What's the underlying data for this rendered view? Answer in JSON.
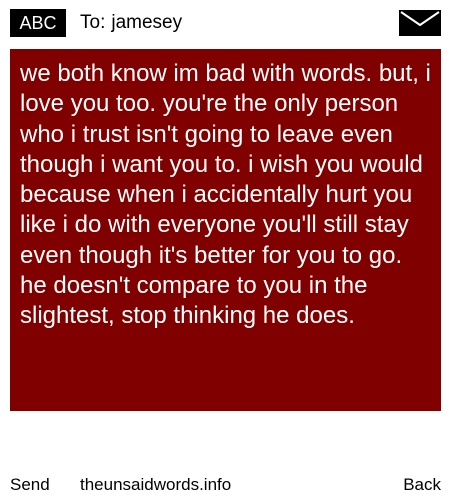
{
  "header": {
    "badge_label": "ABC",
    "to_label": "To:",
    "recipient": "jamesey",
    "mail_icon": "envelope-icon"
  },
  "message": {
    "body": "we both know im bad with words. but, i love you too. you're the only person who i trust isn't going to leave even though i want you to. i wish you would because when i accidentally hurt you like i do with everyone you'll still stay even though it's better for you to go. he doesn't compare to you in the slightest, stop thinking he does.",
    "background_color": "#800000",
    "text_color": "#ffffff"
  },
  "footer": {
    "send_label": "Send",
    "site_label": "theunsaidwords.info",
    "back_label": "Back"
  }
}
